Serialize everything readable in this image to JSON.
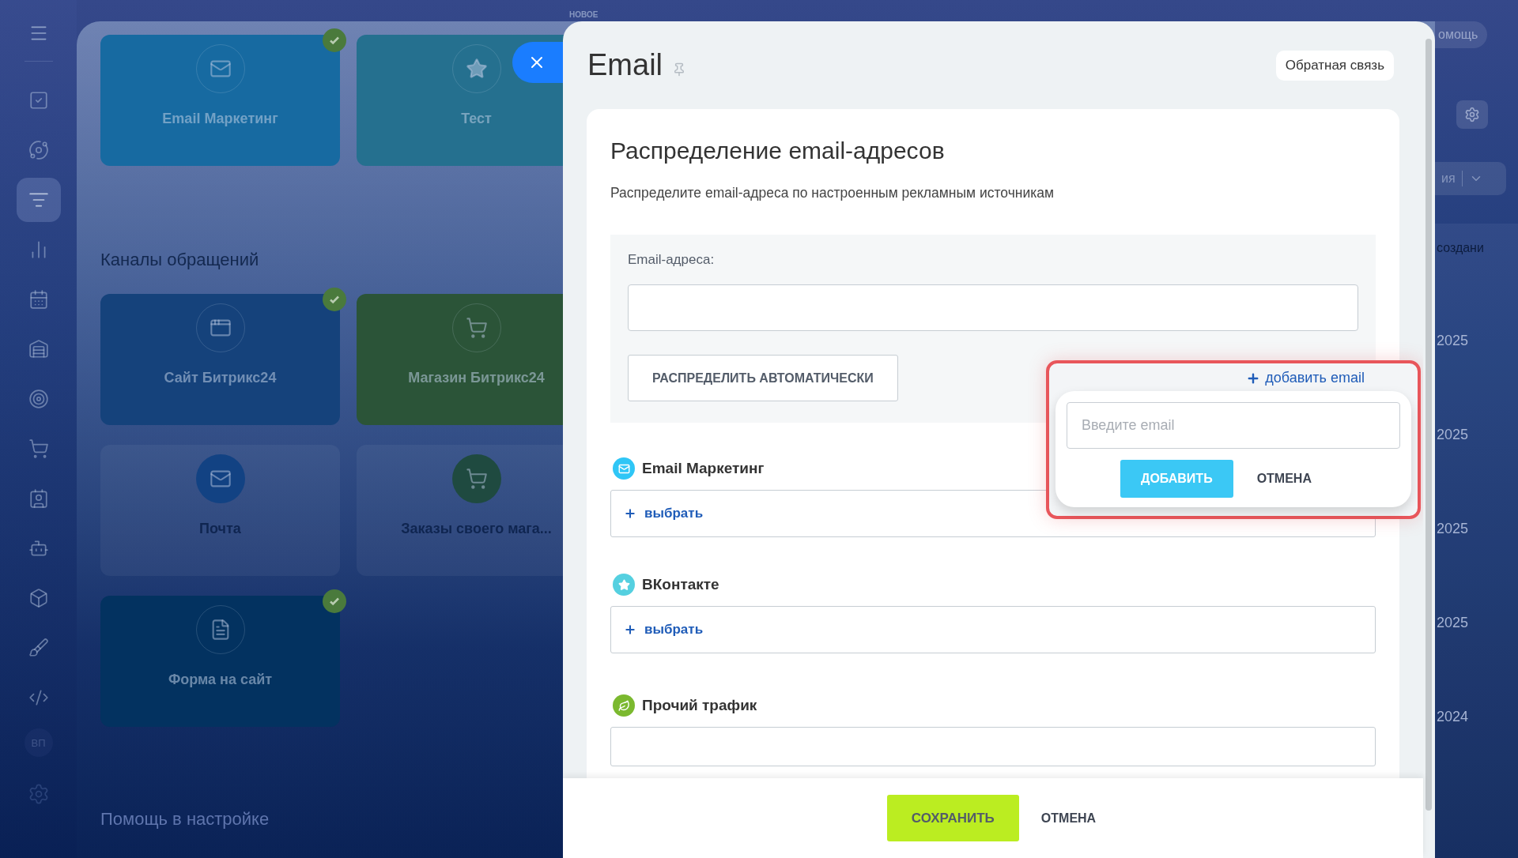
{
  "sidebar": {
    "items": [
      {
        "kind": "tasks",
        "selected": false
      },
      {
        "kind": "crm",
        "selected": false
      },
      {
        "kind": "funnel",
        "selected": true
      },
      {
        "kind": "analytics",
        "selected": false
      },
      {
        "kind": "calendar",
        "selected": false
      },
      {
        "kind": "warehouse",
        "selected": false
      },
      {
        "kind": "target",
        "selected": false
      },
      {
        "kind": "cart",
        "selected": false
      },
      {
        "kind": "contacts",
        "selected": false
      },
      {
        "kind": "robot",
        "selected": false
      },
      {
        "kind": "box",
        "selected": false
      },
      {
        "kind": "marketing",
        "selected": false
      },
      {
        "kind": "code",
        "selected": false
      }
    ],
    "badge": "ВП"
  },
  "background": {
    "tag": "НОВОЕ",
    "tiles": [
      {
        "label": "Email Маркетинг",
        "kind": "email",
        "filled": true,
        "checked": true,
        "color": "#176aa1"
      },
      {
        "label": "Тест",
        "kind": "star",
        "filled": true,
        "checked": false,
        "color": "#25708f"
      }
    ],
    "channels_heading": "Каналы обращений",
    "channels": [
      {
        "label": "Сайт Битрикс24",
        "kind": "site",
        "filled": true,
        "checked": true,
        "color": "#15427b"
      },
      {
        "label": "Магазин Битрикс24",
        "kind": "cart",
        "filled": true,
        "checked": false,
        "color": "#2b5438"
      },
      {
        "label": "Почта",
        "kind": "mail",
        "filled": false,
        "checked": false,
        "color": "#124283"
      },
      {
        "label": "Заказы своего мага...",
        "kind": "cart",
        "filled": false,
        "checked": false,
        "color": "#1f4a40"
      },
      {
        "label": "Форма на сайт",
        "kind": "form",
        "filled": true,
        "checked": true,
        "color": "#033260"
      }
    ],
    "help_heading": "Помощь в настройке",
    "right": {
      "help_button": "омощь",
      "view_selector": "ия",
      "column_header": "создани",
      "dates": [
        "2025",
        "2025",
        "2025",
        "2025",
        "2024"
      ]
    }
  },
  "slider": {
    "title": "Email",
    "feedback_button": "Обратная связь",
    "card": {
      "title": "Распределение email-адресов",
      "description": "Распределите email-адреса по настроенным рекламным источникам",
      "emails": {
        "label": "Email-адреса:",
        "auto_button": "РАСПРЕДЕЛИТЬ АВТОМАТИЧЕСКИ",
        "add_link": "добавить email",
        "popup": {
          "placeholder": "Введите email",
          "add_button": "ДОБАВИТЬ",
          "cancel_button": "ОТМЕНА"
        }
      },
      "sources": [
        {
          "name": "Email Маркетинг",
          "kind": "email",
          "color": "#2fc6f6",
          "action": "выбрать"
        },
        {
          "name": "ВКонтакте",
          "kind": "star",
          "color": "#55d0e0",
          "action": "выбрать"
        },
        {
          "name": "Прочий трафик",
          "kind": "leaf",
          "color": "#7bb92f"
        }
      ]
    },
    "footer": {
      "save_button": "СОХРАНИТЬ",
      "cancel_button": "ОТМЕНА"
    }
  }
}
